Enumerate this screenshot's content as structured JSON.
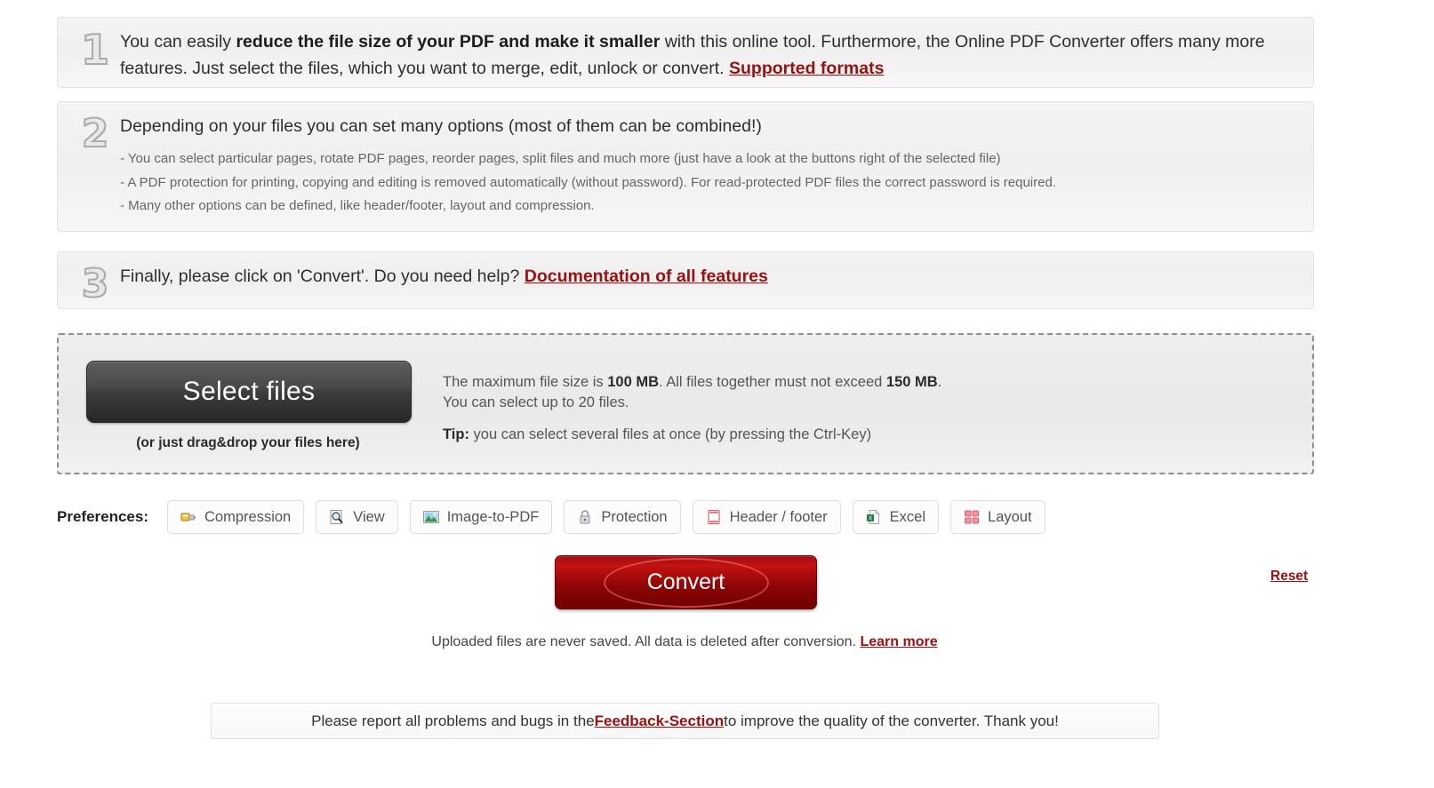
{
  "steps": [
    {
      "number": "1",
      "lead_parts": [
        {
          "t": "You can easily ",
          "b": false
        },
        {
          "t": "reduce the file size of your PDF and make it smaller",
          "b": true
        },
        {
          "t": " with this online tool. Furthermore, the Online PDF Converter offers many more features. Just select the files, which you want to merge, edit, unlock or convert. ",
          "b": false
        }
      ],
      "link": "Supported formats"
    },
    {
      "number": "2",
      "lead_parts": [
        {
          "t": "Depending on your files you can set many options (most of them can be combined!)",
          "b": false
        }
      ],
      "link": "",
      "bullets": [
        "- You can select particular pages, rotate PDF pages, reorder pages, split files and much more (just have a look at the buttons right of the selected file)",
        "- A PDF protection for printing, copying and editing is removed automatically (without password). For read-protected PDF files the correct password is required.",
        "- Many other options can be defined, like header/footer, layout and compression."
      ]
    },
    {
      "number": "3",
      "lead_parts": [
        {
          "t": "Finally, please click on 'Convert'. Do you need help? ",
          "b": false
        }
      ],
      "link": "Documentation of all features"
    }
  ],
  "dropzone": {
    "select_files_label": "Select files",
    "dragdrop_hint": "(or just drag&drop your files here)",
    "info_line1_a": "The maximum file size is ",
    "info_max_size": "100 MB",
    "info_line1_b": ". All files together must not exceed ",
    "info_total_size": "150 MB",
    "info_line1_c": ".",
    "info_line2": "You can select up to 20 files.",
    "tip_label": "Tip:",
    "tip_text": " you can select several files at once (by pressing the Ctrl-Key)"
  },
  "preferences": {
    "label": "Preferences:",
    "buttons": [
      {
        "label": "Compression",
        "icon": "compression-icon"
      },
      {
        "label": "View",
        "icon": "magnifier-page-icon"
      },
      {
        "label": "Image-to-PDF",
        "icon": "image-icon"
      },
      {
        "label": "Protection",
        "icon": "lock-icon"
      },
      {
        "label": "Header / footer",
        "icon": "page-header-footer-icon"
      },
      {
        "label": "Excel",
        "icon": "excel-icon"
      },
      {
        "label": "Layout",
        "icon": "layout-grid-icon"
      }
    ]
  },
  "actions": {
    "convert_label": "Convert",
    "reset_label": "Reset"
  },
  "privacy": {
    "text": "Uploaded files are never saved. All data is deleted after conversion. ",
    "link": "Learn more"
  },
  "feedback": {
    "text_before": "Please report all problems and bugs in the ",
    "link": "Feedback-Section",
    "text_after": " to improve the quality of the converter. Thank you!"
  },
  "colors": {
    "link_red": "#9b1111",
    "convert_red": "#a30c0c",
    "panel_bg": "#f2f2f2"
  }
}
